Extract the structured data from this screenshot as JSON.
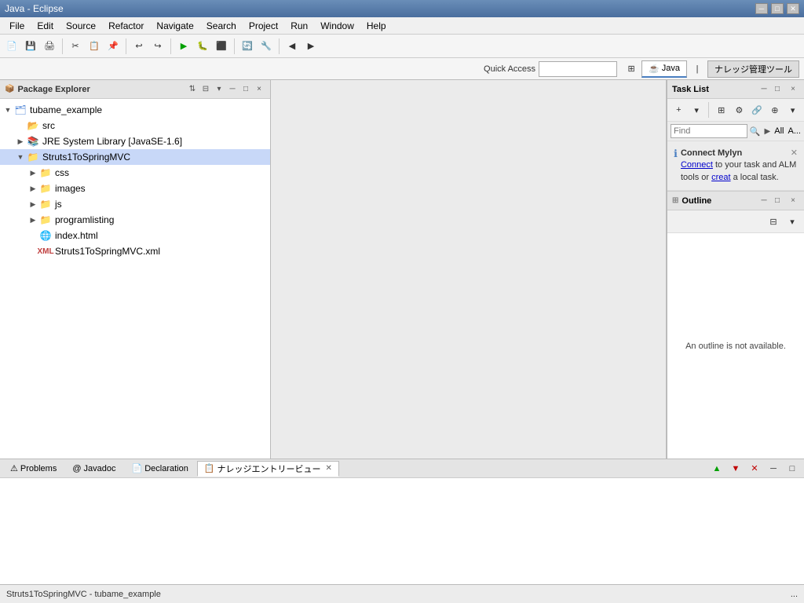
{
  "window": {
    "title": "Java - Eclipse"
  },
  "menu": {
    "items": [
      "File",
      "Edit",
      "Source",
      "Refactor",
      "Navigate",
      "Search",
      "Project",
      "Run",
      "Window",
      "Help"
    ]
  },
  "quickaccess": {
    "label": "Quick Access",
    "placeholder": ""
  },
  "perspectives": [
    {
      "id": "java",
      "label": "Java",
      "active": true
    },
    {
      "id": "knowledge",
      "label": "ナレッジ管理ツール",
      "active": false
    }
  ],
  "package_explorer": {
    "title": "Package Explorer",
    "close_label": "×",
    "tree": [
      {
        "id": "root",
        "label": "tubame_example",
        "indent": 1,
        "type": "project",
        "expanded": true,
        "arrow": "▼"
      },
      {
        "id": "src",
        "label": "src",
        "indent": 2,
        "type": "src",
        "expanded": false,
        "arrow": ""
      },
      {
        "id": "jre",
        "label": "JRE System Library [JavaSE-1.6]",
        "indent": 2,
        "type": "library",
        "expanded": false,
        "arrow": "▶"
      },
      {
        "id": "struts",
        "label": "Struts1ToSpringMVC",
        "indent": 2,
        "type": "folder",
        "expanded": true,
        "arrow": "▼",
        "selected": true
      },
      {
        "id": "css",
        "label": "css",
        "indent": 3,
        "type": "folder",
        "expanded": false,
        "arrow": "▶"
      },
      {
        "id": "images",
        "label": "images",
        "indent": 3,
        "type": "folder",
        "expanded": false,
        "arrow": "▶"
      },
      {
        "id": "js",
        "label": "js",
        "indent": 3,
        "type": "folder",
        "expanded": false,
        "arrow": "▶"
      },
      {
        "id": "programlisting",
        "label": "programlisting",
        "indent": 3,
        "type": "folder",
        "expanded": false,
        "arrow": "▶"
      },
      {
        "id": "index",
        "label": "index.html",
        "indent": 3,
        "type": "html",
        "expanded": false,
        "arrow": ""
      },
      {
        "id": "strutsmvc",
        "label": "Struts1ToSpringMVC.xml",
        "indent": 3,
        "type": "xml",
        "expanded": false,
        "arrow": ""
      }
    ]
  },
  "task_list": {
    "title": "Task List",
    "close_label": "×",
    "find_placeholder": "Find",
    "filter_all": "All",
    "filter_a": "A..."
  },
  "connect_mylyn": {
    "title": "Connect Mylyn",
    "close_label": "×",
    "text_before": " to your task and ALM tools or ",
    "link1": "Connect",
    "link2": "creat",
    "text_after": " a local task."
  },
  "outline": {
    "title": "Outline",
    "close_label": "×",
    "empty_text": "An outline is not available."
  },
  "bottom_tabs": [
    {
      "id": "problems",
      "label": "Problems",
      "icon": "⚠",
      "active": false
    },
    {
      "id": "javadoc",
      "label": "Javadoc",
      "icon": "@",
      "active": false
    },
    {
      "id": "declaration",
      "label": "Declaration",
      "icon": "📄",
      "active": false
    },
    {
      "id": "knowledge",
      "label": "ナレッジエントリービュー",
      "icon": "📋",
      "active": true
    }
  ],
  "status_bar": {
    "text": "Struts1ToSpringMVC - tubame_example",
    "right": "..."
  }
}
